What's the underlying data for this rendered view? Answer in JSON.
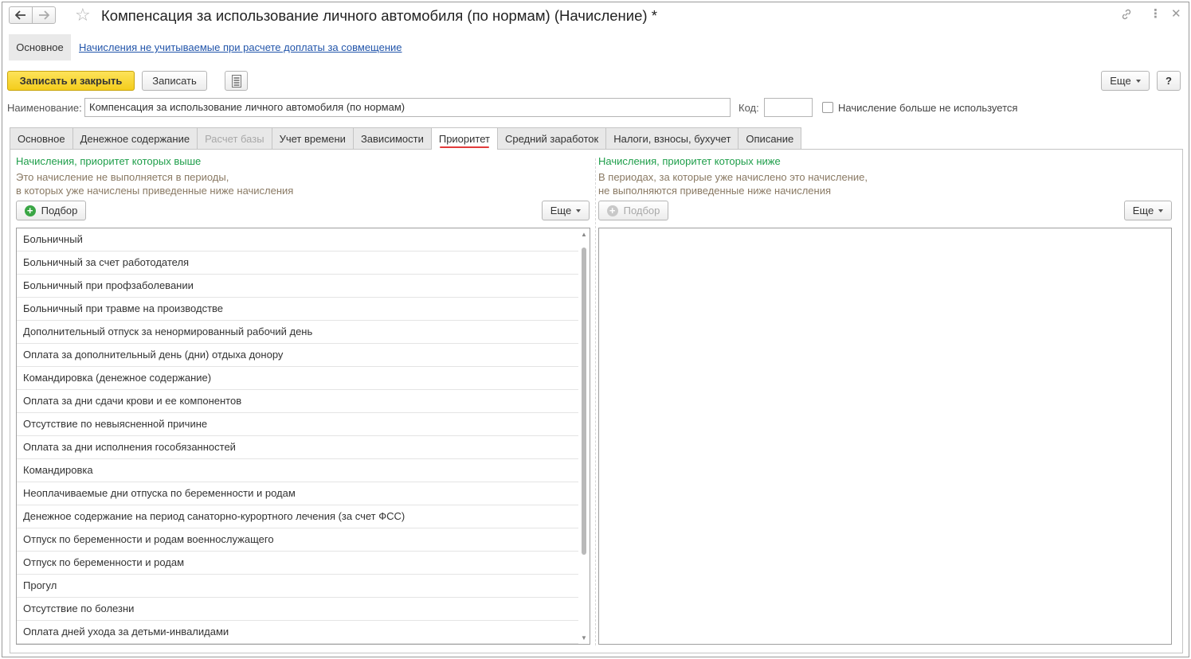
{
  "window": {
    "title": "Компенсация за использование личного автомобиля (по нормам) (Начисление) *",
    "icons": [
      "back-arrow-icon",
      "forward-arrow-icon",
      "star-icon",
      "link-icon",
      "more-icon",
      "close-icon"
    ]
  },
  "sections": {
    "main": "Основное",
    "link": "Начисления не учитываемые при расчете доплаты за совмещение"
  },
  "commandbar": {
    "save_close": "Записать и закрыть",
    "save": "Записать",
    "more": "Еще",
    "help": "?"
  },
  "form": {
    "name_label": "Наименование:",
    "name_value": "Компенсация за использование личного автомобиля (по нормам)",
    "code_label": "Код:",
    "code_value": "",
    "not_used_label": "Начисление больше не используется"
  },
  "tabs": [
    {
      "label": "Основное"
    },
    {
      "label": "Денежное содержание"
    },
    {
      "label": "Расчет базы"
    },
    {
      "label": "Учет времени"
    },
    {
      "label": "Зависимости"
    },
    {
      "label": "Приоритет"
    },
    {
      "label": "Средний заработок"
    },
    {
      "label": "Налоги, взносы, бухучет"
    },
    {
      "label": "Описание"
    }
  ],
  "left": {
    "title": "Начисления, приоритет которых выше",
    "note1": "Это начисление не выполняется в периоды,",
    "note2": "в которых уже начислены приведенные ниже начисления",
    "pick": "Подбор",
    "more": "Еще",
    "items": [
      "Больничный",
      "Больничный за счет работодателя",
      "Больничный при профзаболевании",
      "Больничный при травме на производстве",
      "Дополнительный отпуск за ненормированный рабочий день",
      "Оплата за дополнительный день (дни) отдыха донору",
      "Командировка (денежное содержание)",
      "Оплата за дни сдачи крови и ее компонентов",
      "Отсутствие по невыясненной причине",
      "Оплата за дни исполнения гособязанностей",
      "Командировка",
      "Неоплачиваемые дни отпуска по беременности и родам",
      "Денежное содержание на период санаторно-курортного лечения (за счет ФСС)",
      "Отпуск по беременности и родам военнослужащего",
      "Отпуск по беременности и родам",
      "Прогул",
      "Отсутствие по болезни",
      "Оплата дней ухода за детьми-инвалидами"
    ]
  },
  "right": {
    "title": "Начисления, приоритет которых ниже",
    "note1": "В периодах, за которые уже начислено это начисление,",
    "note2": "не выполняются приведенные ниже начисления",
    "pick": "Подбор",
    "more": "Еще"
  }
}
